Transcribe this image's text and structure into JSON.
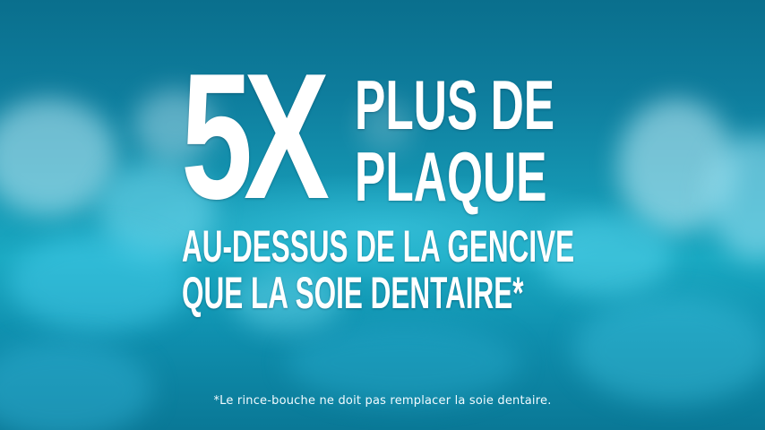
{
  "headline": {
    "big_number": "5X",
    "line_1": "PLUS DE",
    "line_2": "PLAQUE",
    "line_3": "AU-DESSUS DE LA GENCIVE",
    "line_4": "QUE LA SOIE DENTAIRE*"
  },
  "disclaimer": "*Le rince-bouche ne doit pas remplacer la soie dentaire.",
  "colors": {
    "background": "#1597b3",
    "text": "#ffffff"
  }
}
